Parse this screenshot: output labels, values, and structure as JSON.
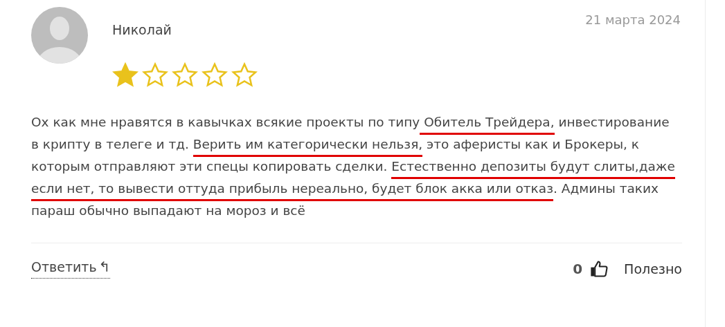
{
  "review": {
    "author": "Николай",
    "date": "21 марта 2024",
    "stars": 1,
    "segments": [
      {
        "text": "Ох как мне нравятся в кавычках всякие проекты по типу",
        "underlined": false
      },
      {
        "text": " Обитель Трейдера,",
        "underlined": true
      },
      {
        "text": " инвестирование в крипту в телеге и тд. ",
        "underlined": false
      },
      {
        "text": "Верить им категорически нельзя,",
        "underlined": true
      },
      {
        "text": " это аферисты как и Брокеры, к которым отправляют эти спецы копировать сделки. ",
        "underlined": false
      },
      {
        "text": "Естественно депозиты будут слиты,даже если нет, то вывести оттуда прибыль нереально, будет блок акка или отказ",
        "underlined": true
      },
      {
        "text": ". Админы таких параш обычно выпадают на мороз и всё",
        "underlined": false
      }
    ],
    "reply_label": "Ответить",
    "reply_icon": "↰",
    "likes": "0",
    "helpful_label": "Полезно"
  }
}
